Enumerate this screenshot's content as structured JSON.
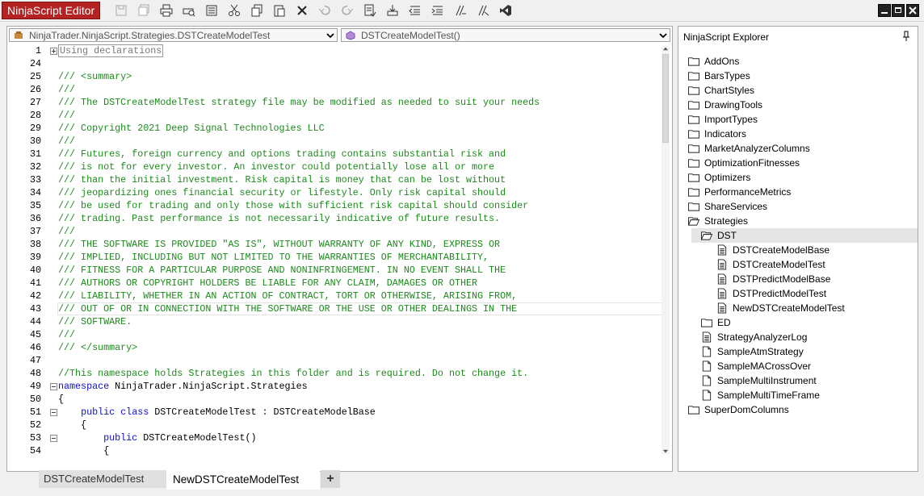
{
  "app": {
    "title": "NinjaScript Editor"
  },
  "toolbar": {
    "icons": [
      "save-icon",
      "save-all-icon",
      "print-icon",
      "print-preview-icon",
      "properties-icon",
      "cut-icon",
      "copy-icon",
      "paste-icon",
      "delete-icon",
      "undo-icon",
      "redo-icon",
      "compile-icon",
      "import-icon",
      "outdent-icon",
      "indent-icon",
      "comment-icon",
      "uncomment-icon",
      "visual-studio-icon"
    ]
  },
  "editor": {
    "class_dropdown": "NinjaTrader.NinjaScript.Strategies.DSTCreateModelTest",
    "member_dropdown": "DSTCreateModelTest()",
    "lines": [
      {
        "n": "1",
        "fold": "plus",
        "parts": [
          {
            "t": "Using declarations",
            "c": "boxed"
          }
        ]
      },
      {
        "n": "24",
        "parts": []
      },
      {
        "n": "25",
        "parts": [
          {
            "t": "/// <summary>",
            "c": "c"
          }
        ]
      },
      {
        "n": "26",
        "parts": [
          {
            "t": "///",
            "c": "c"
          }
        ]
      },
      {
        "n": "27",
        "parts": [
          {
            "t": "/// The DSTCreateModelTest strategy file may be modified as needed to suit your needs",
            "c": "c"
          }
        ]
      },
      {
        "n": "28",
        "parts": [
          {
            "t": "///",
            "c": "c"
          }
        ]
      },
      {
        "n": "29",
        "parts": [
          {
            "t": "/// Copyright 2021 Deep Signal Technologies LLC",
            "c": "c"
          }
        ]
      },
      {
        "n": "30",
        "parts": [
          {
            "t": "///",
            "c": "c"
          }
        ]
      },
      {
        "n": "31",
        "parts": [
          {
            "t": "/// Futures, foreign currency and options trading contains substantial risk and",
            "c": "c"
          }
        ]
      },
      {
        "n": "32",
        "parts": [
          {
            "t": "/// is not for every investor. An investor could potentially lose all or more",
            "c": "c"
          }
        ]
      },
      {
        "n": "33",
        "parts": [
          {
            "t": "/// than the initial investment. Risk capital is money that can be lost without",
            "c": "c"
          }
        ]
      },
      {
        "n": "34",
        "parts": [
          {
            "t": "/// jeopardizing ones financial security or lifestyle. Only risk capital should",
            "c": "c"
          }
        ]
      },
      {
        "n": "35",
        "parts": [
          {
            "t": "/// be used for trading and only those with sufficient risk capital should consider",
            "c": "c"
          }
        ]
      },
      {
        "n": "36",
        "parts": [
          {
            "t": "/// trading. Past performance is not necessarily indicative of future results.",
            "c": "c"
          }
        ]
      },
      {
        "n": "37",
        "parts": [
          {
            "t": "///",
            "c": "c"
          }
        ]
      },
      {
        "n": "38",
        "parts": [
          {
            "t": "/// THE SOFTWARE IS PROVIDED \"AS IS\", WITHOUT WARRANTY OF ANY KIND, EXPRESS OR",
            "c": "c"
          }
        ]
      },
      {
        "n": "39",
        "parts": [
          {
            "t": "/// IMPLIED, INCLUDING BUT NOT LIMITED TO THE WARRANTIES OF MERCHANTABILITY,",
            "c": "c"
          }
        ]
      },
      {
        "n": "40",
        "parts": [
          {
            "t": "/// FITNESS FOR A PARTICULAR PURPOSE AND NONINFRINGEMENT. IN NO EVENT SHALL THE",
            "c": "c"
          }
        ]
      },
      {
        "n": "41",
        "parts": [
          {
            "t": "/// AUTHORS OR COPYRIGHT HOLDERS BE LIABLE FOR ANY CLAIM, DAMAGES OR OTHER",
            "c": "c"
          }
        ]
      },
      {
        "n": "42",
        "parts": [
          {
            "t": "/// LIABILITY, WHETHER IN AN ACTION OF CONTRACT, TORT OR OTHERWISE, ARISING FROM,",
            "c": "c"
          }
        ]
      },
      {
        "n": "43",
        "hl": true,
        "parts": [
          {
            "t": "/// OUT OF OR IN CONNECTION WITH THE SOFTWARE OR THE USE OR OTHER DEALINGS IN THE",
            "c": "c"
          }
        ]
      },
      {
        "n": "44",
        "parts": [
          {
            "t": "/// SOFTWARE.",
            "c": "c"
          }
        ]
      },
      {
        "n": "45",
        "parts": [
          {
            "t": "///",
            "c": "c"
          }
        ]
      },
      {
        "n": "46",
        "parts": [
          {
            "t": "/// </summary>",
            "c": "c"
          }
        ]
      },
      {
        "n": "47",
        "parts": []
      },
      {
        "n": "48",
        "parts": [
          {
            "t": "//This namespace holds Strategies in this folder and is required. Do not change it.",
            "c": "c"
          }
        ]
      },
      {
        "n": "49",
        "fold": "minus",
        "parts": [
          {
            "t": "namespace",
            "c": "k"
          },
          {
            "t": " NinjaTrader.NinjaScript.Strategies",
            "c": ""
          }
        ]
      },
      {
        "n": "50",
        "parts": [
          {
            "t": "{",
            "c": ""
          }
        ]
      },
      {
        "n": "51",
        "fold": "minus",
        "parts": [
          {
            "t": "    ",
            "c": ""
          },
          {
            "t": "public",
            "c": "k"
          },
          {
            "t": " ",
            "c": ""
          },
          {
            "t": "class",
            "c": "k"
          },
          {
            "t": " DSTCreateModelTest : DSTCreateModelBase",
            "c": ""
          }
        ]
      },
      {
        "n": "52",
        "parts": [
          {
            "t": "    {",
            "c": ""
          }
        ]
      },
      {
        "n": "53",
        "fold": "minus",
        "parts": [
          {
            "t": "        ",
            "c": ""
          },
          {
            "t": "public",
            "c": "k"
          },
          {
            "t": " DSTCreateModelTest()",
            "c": ""
          }
        ]
      },
      {
        "n": "54",
        "parts": [
          {
            "t": "        {",
            "c": ""
          }
        ]
      }
    ]
  },
  "explorer": {
    "title": "NinjaScript Explorer",
    "items": [
      {
        "label": "AddOns",
        "type": "folder",
        "level": 0
      },
      {
        "label": "BarsTypes",
        "type": "folder",
        "level": 0
      },
      {
        "label": "ChartStyles",
        "type": "folder",
        "level": 0
      },
      {
        "label": "DrawingTools",
        "type": "folder",
        "level": 0
      },
      {
        "label": "ImportTypes",
        "type": "folder",
        "level": 0
      },
      {
        "label": "Indicators",
        "type": "folder",
        "level": 0
      },
      {
        "label": "MarketAnalyzerColumns",
        "type": "folder",
        "level": 0
      },
      {
        "label": "OptimizationFitnesses",
        "type": "folder",
        "level": 0
      },
      {
        "label": "Optimizers",
        "type": "folder",
        "level": 0
      },
      {
        "label": "PerformanceMetrics",
        "type": "folder",
        "level": 0
      },
      {
        "label": "ShareServices",
        "type": "folder",
        "level": 0
      },
      {
        "label": "Strategies",
        "type": "folder-open",
        "level": 0
      },
      {
        "label": "DST",
        "type": "folder-open",
        "level": 1,
        "selected": true
      },
      {
        "label": "DSTCreateModelBase",
        "type": "file-lines",
        "level": 2
      },
      {
        "label": "DSTCreateModelTest",
        "type": "file-lines",
        "level": 2
      },
      {
        "label": "DSTPredictModelBase",
        "type": "file-lines",
        "level": 2
      },
      {
        "label": "DSTPredictModelTest",
        "type": "file-lines",
        "level": 2
      },
      {
        "label": "NewDSTCreateModelTest",
        "type": "file-lines",
        "level": 2
      },
      {
        "label": "ED",
        "type": "folder",
        "level": 1
      },
      {
        "label": "StrategyAnalyzerLog",
        "type": "file-lines",
        "level": 1
      },
      {
        "label": "SampleAtmStrategy",
        "type": "file",
        "level": 1
      },
      {
        "label": "SampleMACrossOver",
        "type": "file",
        "level": 1
      },
      {
        "label": "SampleMultiInstrument",
        "type": "file",
        "level": 1
      },
      {
        "label": "SampleMultiTimeFrame",
        "type": "file",
        "level": 1
      },
      {
        "label": "SuperDomColumns",
        "type": "folder",
        "level": 0
      }
    ]
  },
  "tabs": {
    "inactive": "DSTCreateModelTest",
    "active": "NewDSTCreateModelTest",
    "add": "+"
  }
}
